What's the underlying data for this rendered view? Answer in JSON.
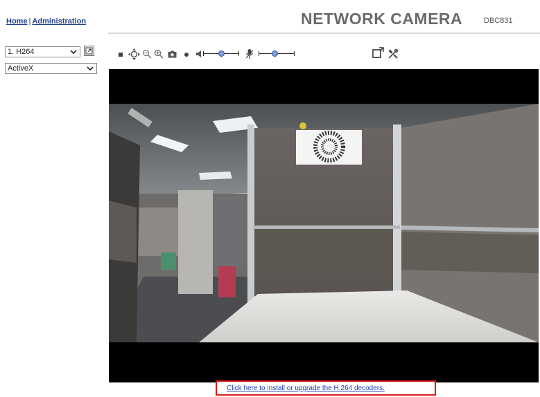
{
  "header": {
    "nav_home": "Home",
    "nav_separator": "|",
    "nav_admin": "Administration",
    "brand": "NETWORK CAMERA",
    "model": "DBC831"
  },
  "controls": {
    "stream_select": {
      "value": "1. H264"
    },
    "plugin_select": {
      "value": "ActiveX"
    }
  },
  "toolbar": {
    "icons": [
      "stop-icon",
      "ptz-icon",
      "zoom-out-icon",
      "zoom-in-icon",
      "snapshot-icon",
      "record-icon",
      "speaker-icon",
      "volume-slider",
      "microphone-icon",
      "mic-slider",
      "fullscreen-icon",
      "settings-icon"
    ],
    "speaker_volume": 0.5,
    "mic_volume": 0.45
  },
  "video": {
    "image_description_icon": "camera-live-view"
  },
  "footer": {
    "decoder_link": "Click here to install or upgrade the H.264 decoders."
  },
  "colors": {
    "link": "#1f3f8f",
    "brand": "#6b6b6b",
    "highlight_box": "#e01a1a",
    "slider_knob": "#7b9fd4"
  }
}
